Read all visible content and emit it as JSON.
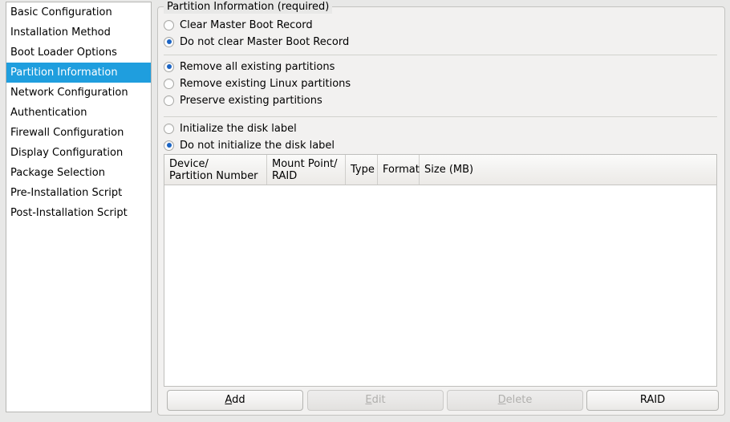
{
  "sidebar": {
    "items": [
      {
        "label": "Basic Configuration",
        "selected": false
      },
      {
        "label": "Installation Method",
        "selected": false
      },
      {
        "label": "Boot Loader Options",
        "selected": false
      },
      {
        "label": "Partition Information",
        "selected": true
      },
      {
        "label": "Network Configuration",
        "selected": false
      },
      {
        "label": "Authentication",
        "selected": false
      },
      {
        "label": "Firewall Configuration",
        "selected": false
      },
      {
        "label": "Display Configuration",
        "selected": false
      },
      {
        "label": "Package Selection",
        "selected": false
      },
      {
        "label": "Pre-Installation Script",
        "selected": false
      },
      {
        "label": "Post-Installation Script",
        "selected": false
      }
    ],
    "selection_color": "#1f9ede"
  },
  "groupbox": {
    "title": "Partition Information (required)"
  },
  "mbr_group": {
    "options": [
      {
        "label": "Clear Master Boot Record",
        "checked": false
      },
      {
        "label": "Do not clear Master Boot Record",
        "checked": true
      }
    ]
  },
  "partitions_group": {
    "options": [
      {
        "label": "Remove all existing partitions",
        "checked": true
      },
      {
        "label": "Remove existing Linux partitions",
        "checked": false
      },
      {
        "label": "Preserve existing partitions",
        "checked": false
      }
    ]
  },
  "disklabel_group": {
    "options": [
      {
        "label": "Initialize the disk label",
        "checked": false
      },
      {
        "label": "Do not initialize the disk label",
        "checked": true
      }
    ]
  },
  "partition_table": {
    "columns": [
      {
        "line1": "Device/",
        "line2": "Partition Number"
      },
      {
        "line1": "Mount Point/",
        "line2": "RAID"
      },
      {
        "line1": "Type",
        "line2": ""
      },
      {
        "line1": "Format",
        "line2": ""
      },
      {
        "line1": "Size (MB)",
        "line2": ""
      }
    ],
    "rows": []
  },
  "buttons": [
    {
      "label": "Add",
      "mnemonic": "A",
      "enabled": true
    },
    {
      "label": "Edit",
      "mnemonic": "E",
      "enabled": false
    },
    {
      "label": "Delete",
      "mnemonic": "D",
      "enabled": false
    },
    {
      "label": "RAID",
      "mnemonic": "",
      "enabled": true
    }
  ],
  "radio_colors": {
    "selected_dot": "#1b64c4",
    "ring": "#a8a8a5"
  }
}
